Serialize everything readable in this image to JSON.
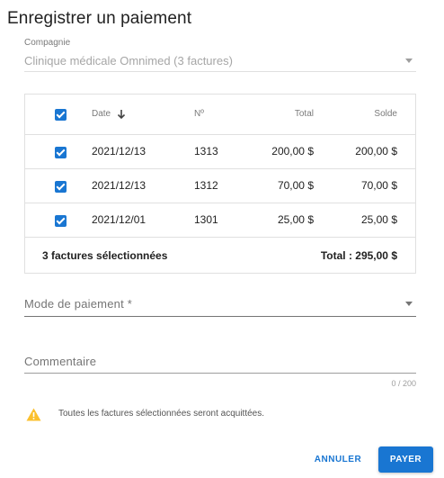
{
  "dialog": {
    "title": "Enregistrer un paiement"
  },
  "company": {
    "label": "Compagnie",
    "value": "Clinique médicale Omnimed (3 factures)"
  },
  "table": {
    "headers": {
      "date": "Date",
      "number": "Nº",
      "total": "Total",
      "balance": "Solde"
    },
    "sort": {
      "column": "date",
      "direction": "descending"
    },
    "rows": [
      {
        "date": "2021/12/13",
        "number": "1313",
        "total": "200,00 $",
        "balance": "200,00 $",
        "selected": true
      },
      {
        "date": "2021/12/13",
        "number": "1312",
        "total": "70,00 $",
        "balance": "70,00 $",
        "selected": true
      },
      {
        "date": "2021/12/01",
        "number": "1301",
        "total": "25,00 $",
        "balance": "25,00 $",
        "selected": true
      }
    ],
    "footer": {
      "selected_count": "3 factures sélectionnées",
      "total": "Total : 295,00 $"
    }
  },
  "payment_mode": {
    "label": "Mode de paiement *"
  },
  "comment": {
    "placeholder": "Commentaire",
    "counter": "0 / 200"
  },
  "warning": {
    "icon": "warning-icon",
    "text": "Toutes les factures sélectionnées seront acquittées.",
    "color": "#fbc02d"
  },
  "actions": {
    "cancel_label": "ANNULER",
    "submit_label": "PAYER"
  },
  "colors": {
    "accent": "#1976d2"
  }
}
